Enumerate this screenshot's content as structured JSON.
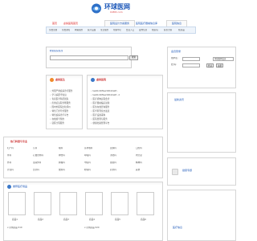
{
  "header": {
    "logo_title": "环球医网",
    "logo_sub": "04M3.com",
    "tabs": [
      "首页",
      "虚拟医院首页",
      "医院设计方案服务",
      "医院医疗器械信息库",
      "医院信息"
    ]
  },
  "navbar": {
    "items": [
      "免费注册",
      "免费通知",
      "网站服务",
      "医疗设备",
      "生活服务",
      "帮助中心",
      "会员入口",
      "发布信息",
      "找医院",
      "医生咨询",
      "找药品"
    ]
  },
  "search": {
    "title": "检索医院/医生",
    "placeholder": "",
    "button": "搜索"
  },
  "left_panel": {
    "title": "虚拟医生",
    "items": [
      "外国严重疾病诊疗服务",
      "学习病原学知识",
      "专家医学科研团队",
      "危重症远程诊断服务",
      "国内外医院比较评价",
      "特色门诊导诊服务",
      "特色疾病诊疗平台",
      "在线挂号预约",
      "就医全程服务"
    ]
  },
  "mid_panel": {
    "title": "虚拟医院",
    "items": [
      "test0c26fbe2d0102e0f..",
      "test0c26fbe2d0102e0f.. 2",
      "医疗机构远程会诊",
      "医疗器械临床试验",
      "医生在线咨询服务",
      "医学期刊论文发表",
      "医疗设备采购",
      "医院管理与服务",
      "健康档案管理平台"
    ]
  },
  "category_panel": {
    "title": "热门科室与专业",
    "rows": [
      [
        "妇产科",
        "儿科",
        "眼科",
        "耳鼻喉科",
        "皮肤科",
        "口腔科"
      ],
      [
        "骨科",
        "心血管内科",
        "神经科",
        "呼吸科",
        "消化科",
        "内分泌"
      ],
      [
        "外科",
        "泌尿外科",
        "肿瘤科",
        "中医科",
        "康复科",
        "精神科"
      ],
      [
        "针灸科",
        "急诊科",
        "放射科",
        "检验科",
        "药剂科",
        "其他"
      ]
    ]
  },
  "promo_panel": {
    "title": "推荐医疗用品",
    "thumbs": [
      "商品1",
      "商品2",
      "商品3",
      "商品4",
      "商品5",
      "商品6"
    ],
    "bottom_lines": [
      "x 示例商品 ¥10",
      "x 示例商品 ¥20"
    ]
  },
  "login": {
    "title": "会员登录",
    "username_label": "用户名:",
    "password_label": "密 码:",
    "select_value": "环球医网会员",
    "login_button": "登录",
    "register_button": "注册"
  },
  "right_panel_1": {
    "title": "最新资讯"
  },
  "right_panel_2": {
    "title": "健康专题"
  },
  "right_panel_3": {
    "title": "医疗信息"
  },
  "colors": {
    "brand_blue": "#1a56b8",
    "accent_red": "#d22222",
    "icon_orange": "#f08a2a",
    "icon_blue": "#3b78c8"
  }
}
